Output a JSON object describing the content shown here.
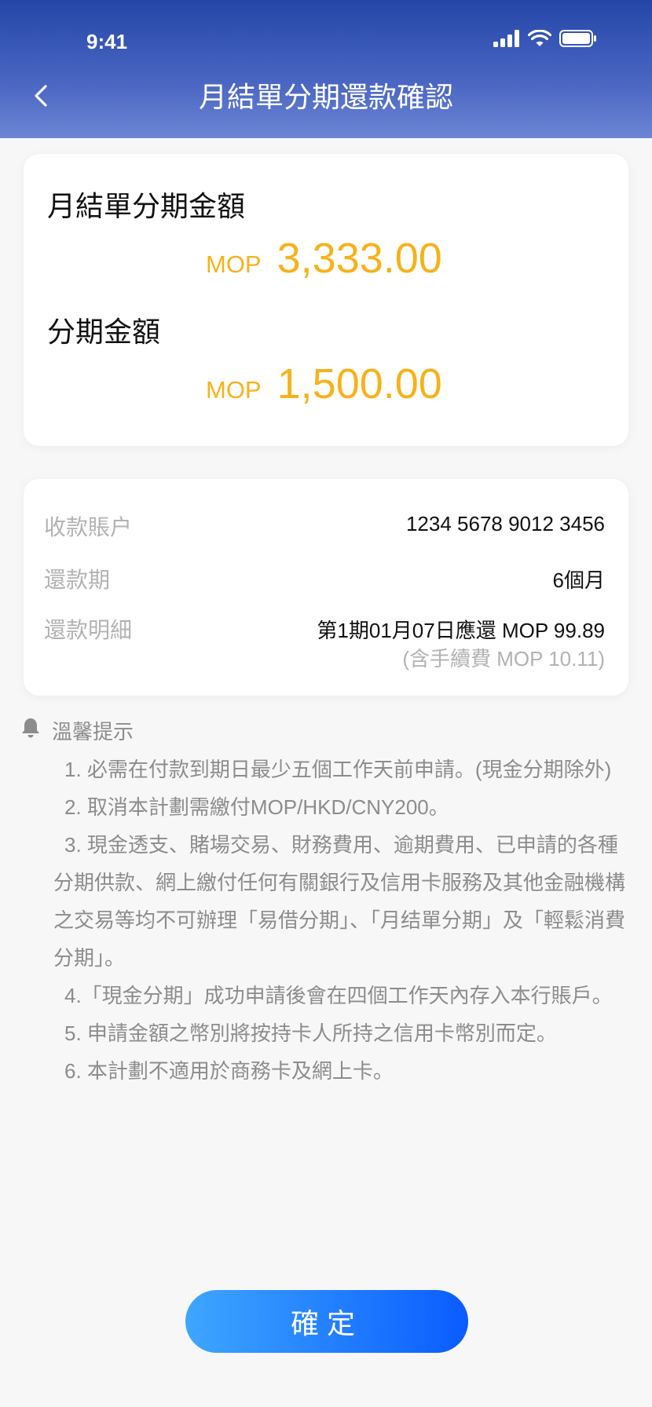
{
  "status_bar": {
    "time": "9:41",
    "icons": [
      "signal-icon",
      "wifi-icon",
      "battery-icon"
    ]
  },
  "nav": {
    "back_icon": "chevron-left-icon",
    "title": "月結單分期還款確認"
  },
  "amounts": {
    "statement_label": "月結單分期金額",
    "statement_currency": "MOP",
    "statement_value": "3,333.00",
    "installment_label": "分期金額",
    "installment_currency": "MOP",
    "installment_value": "1,500.00"
  },
  "details": {
    "account_label": "收款賬户",
    "account_value": "1234 5678 9012 3456",
    "period_label": "還款期",
    "period_value": "6個月",
    "breakdown_label": "還款明細",
    "breakdown_value": "第1期01月07日應還 MOP 99.89",
    "breakdown_fee": "(含手續費 MOP 10.11)"
  },
  "tips": {
    "icon": "bell-icon",
    "title": "溫馨提示",
    "items": [
      "1. 必需在付款到期日最少五個工作天前申請。(現金分期除外)",
      "2. 取消本計劃需繳付MOP/HKD/CNY200。",
      "3. 現金透支、賭場交易、財務費用、逾期費用、已申請的各種分期供款、網上繳付任何有關銀行及信用卡服務及其他金融機構之交易等均不可辦理「易借分期」、「月结單分期」及「輕鬆消費分期」。",
      "4.「現金分期」成功申請後會在四個工作天內存入本行賬戶。",
      "5. 申請金額之幣別將按持卡人所持之信用卡幣別而定。",
      "6. 本計劃不適用於商務卡及網上卡。"
    ]
  },
  "confirm_button": {
    "label": "確定"
  },
  "colors": {
    "header_top": "#2446a8",
    "header_bottom": "#6c85d4",
    "amount": "#f6b21b",
    "muted_text": "#8c8c8c",
    "button_start": "#3ea6ff",
    "button_end": "#0a5cff"
  }
}
